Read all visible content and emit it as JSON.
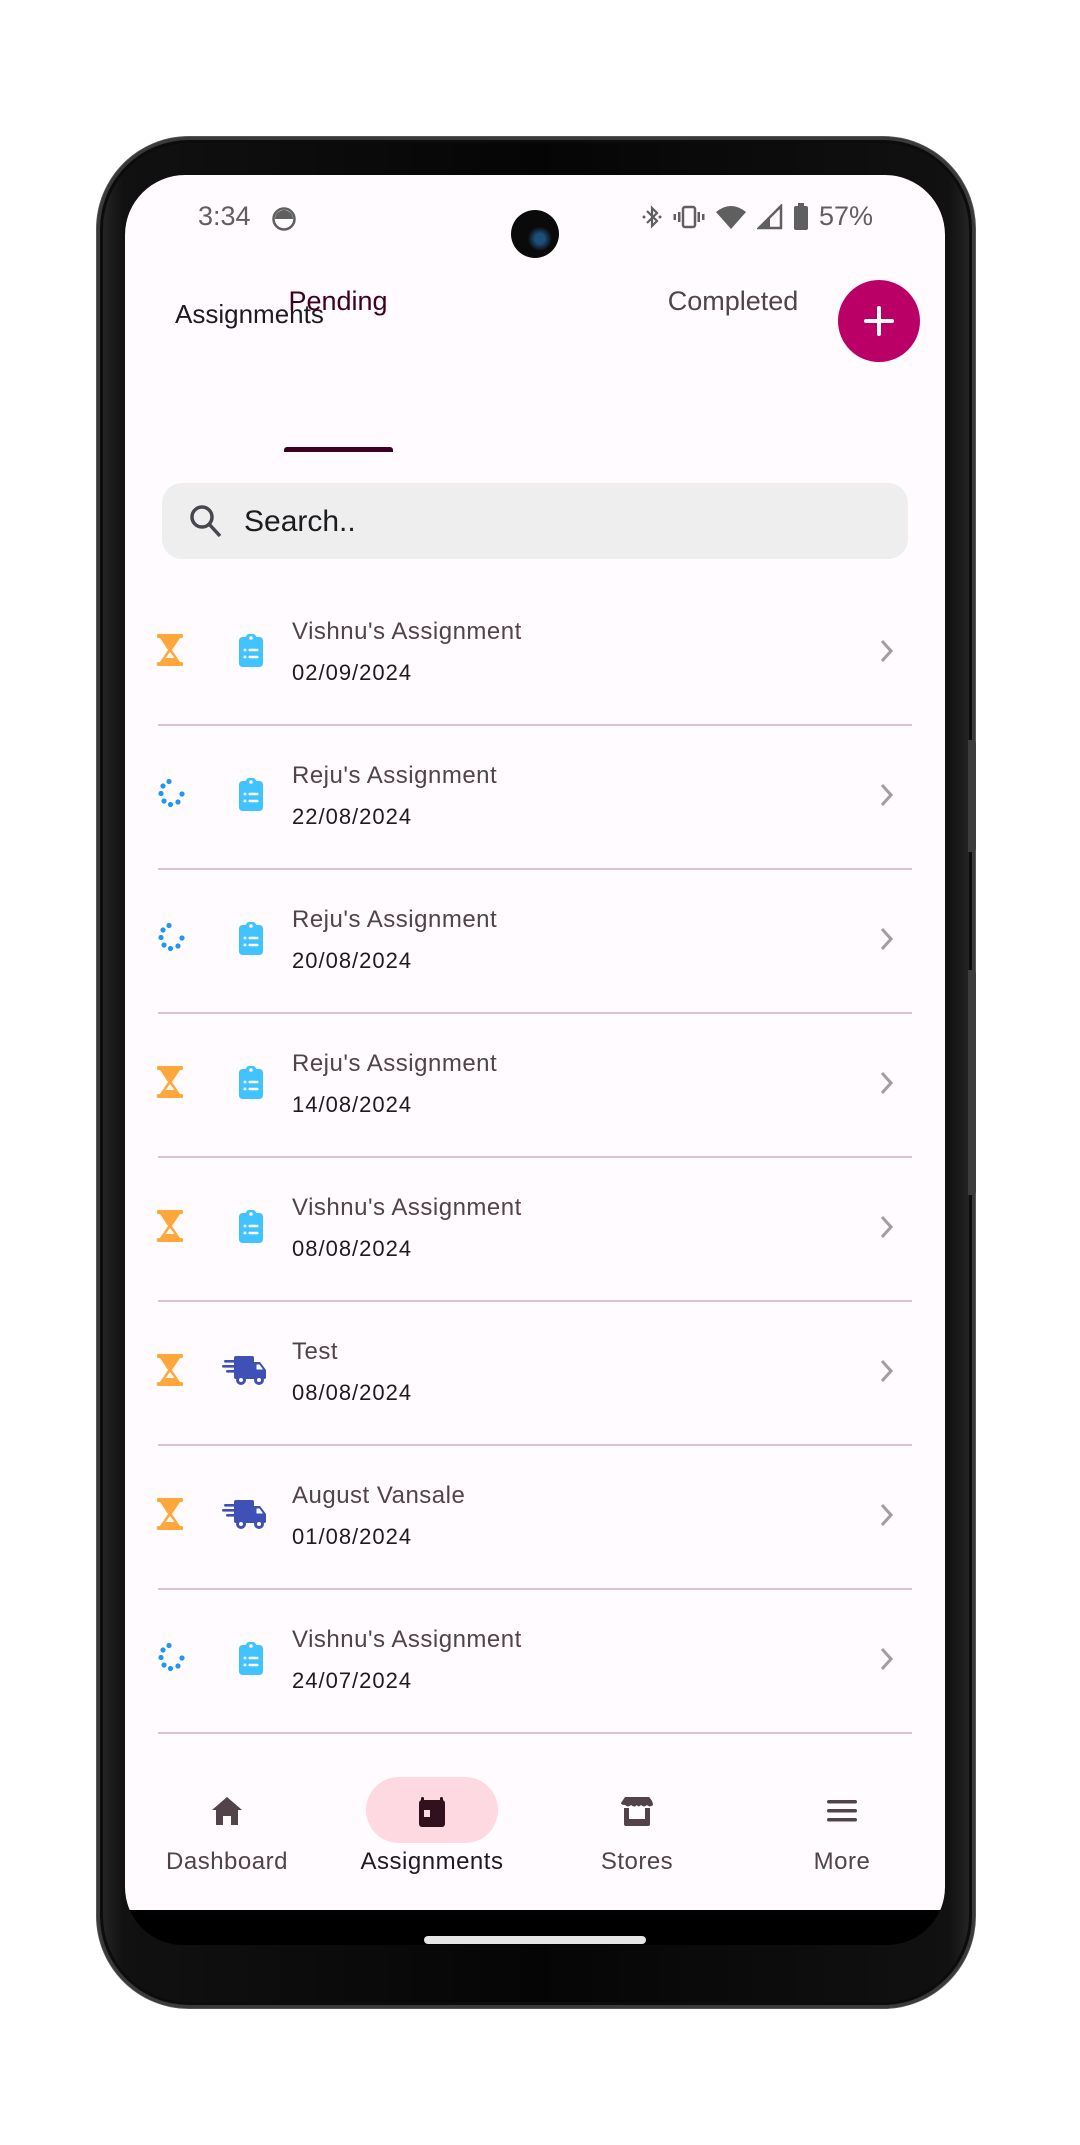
{
  "status_bar": {
    "time": "3:34",
    "battery": "57%",
    "icons": [
      "android-face-icon",
      "bluetooth-icon",
      "vibrate-icon",
      "wifi-icon",
      "signal-icon",
      "battery-icon"
    ]
  },
  "header": {
    "title": "Assignments",
    "fab_icon": "plus-icon",
    "fab_color": "#ba0066"
  },
  "tabs": [
    {
      "label": "Pending",
      "active": true
    },
    {
      "label": "Completed",
      "active": false
    }
  ],
  "search": {
    "placeholder": "Search..",
    "value": ""
  },
  "colors": {
    "pending_status": "#ffa73a",
    "in_progress_status": "#2196f3",
    "clipboard_type": "#40c4ff",
    "delivery_type": "#3f51b5",
    "accent": "#ba0066",
    "nav_active_pill": "#ffd9e1"
  },
  "assignments": [
    {
      "title": "Vishnu's Assignment",
      "date": "02/09/2024",
      "status_icon": "hourglass-icon",
      "type_icon": "clipboard-list-icon"
    },
    {
      "title": "Reju's Assignment",
      "date": "22/08/2024",
      "status_icon": "loading-dots-icon",
      "type_icon": "clipboard-list-icon"
    },
    {
      "title": "Reju's Assignment",
      "date": "20/08/2024",
      "status_icon": "loading-dots-icon",
      "type_icon": "clipboard-list-icon"
    },
    {
      "title": "Reju's Assignment",
      "date": "14/08/2024",
      "status_icon": "hourglass-icon",
      "type_icon": "clipboard-list-icon"
    },
    {
      "title": "Vishnu's Assignment",
      "date": "08/08/2024",
      "status_icon": "hourglass-icon",
      "type_icon": "clipboard-list-icon"
    },
    {
      "title": "Test",
      "date": "08/08/2024",
      "status_icon": "hourglass-icon",
      "type_icon": "delivery-truck-icon"
    },
    {
      "title": "August Vansale",
      "date": "01/08/2024",
      "status_icon": "hourglass-icon",
      "type_icon": "delivery-truck-icon"
    },
    {
      "title": "Vishnu's Assignment",
      "date": "24/07/2024",
      "status_icon": "loading-dots-icon",
      "type_icon": "clipboard-list-icon"
    }
  ],
  "bottom_nav": [
    {
      "label": "Dashboard",
      "icon": "home-icon",
      "active": false
    },
    {
      "label": "Assignments",
      "icon": "calendar-icon",
      "active": true
    },
    {
      "label": "Stores",
      "icon": "storefront-icon",
      "active": false
    },
    {
      "label": "More",
      "icon": "menu-icon",
      "active": false
    }
  ]
}
